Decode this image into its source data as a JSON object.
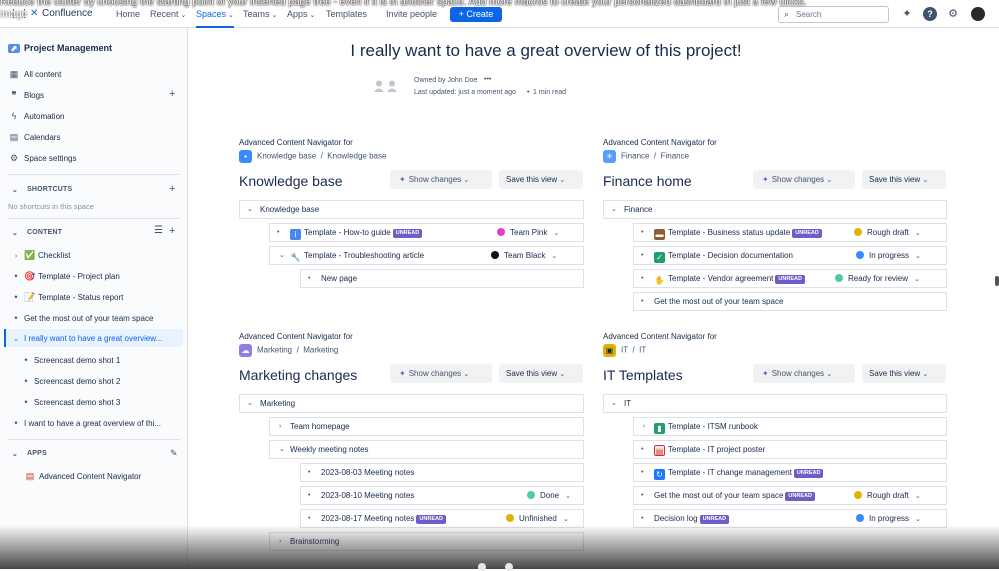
{
  "overlay": {
    "line1": "Reduce the clutter by choosing the starting point of your inserted page tree - even if it is in another space. Add more macros to create your personalized dashboard in just a few clicks.",
    "line2": "image"
  },
  "topnav": {
    "brand": "Confluence",
    "home": "Home",
    "recent": "Recent",
    "spaces": "Spaces",
    "teams": "Teams",
    "apps": "Apps",
    "templates": "Templates",
    "invite": "Invite people",
    "create": "Create",
    "search_placeholder": "Search",
    "accent": "#0c66e4"
  },
  "sidebar": {
    "space_name": "Project Management",
    "nav": [
      {
        "label": "All content",
        "icon": "grid-icon"
      },
      {
        "label": "Blogs",
        "icon": "quote-icon"
      },
      {
        "label": "Automation",
        "icon": "bolt-icon"
      },
      {
        "label": "Calendars",
        "icon": "calendar-icon"
      },
      {
        "label": "Space settings",
        "icon": "gear-icon"
      }
    ],
    "shortcuts_header": "SHORTCUTS",
    "shortcuts_empty": "No shortcuts in this space",
    "content_header": "CONTENT",
    "tree": [
      {
        "label": "Checklist",
        "emoji": "✅"
      },
      {
        "label": "Template - Project plan",
        "emoji": "🎯"
      },
      {
        "label": "Template - Status report",
        "emoji": "📝"
      },
      {
        "label": "Get the most out of your team space",
        "emoji": ""
      },
      {
        "label": "I really want to have a great overview...",
        "emoji": ""
      },
      {
        "label": "Screencast demo shot 1",
        "emoji": ""
      },
      {
        "label": "Screencast demo shot 2",
        "emoji": ""
      },
      {
        "label": "Screencast demo shot 3",
        "emoji": ""
      },
      {
        "label": "I want to have a great overview of thi...",
        "emoji": ""
      }
    ],
    "apps_header": "APPS",
    "apps": [
      {
        "label": "Advanced Content Navigator"
      }
    ]
  },
  "page": {
    "title": "I really want to have a great overview of this project!",
    "owner": "Owned by John Doe",
    "more": "•••",
    "updated": "Last updated: just a moment ago",
    "read_time": "1 min read"
  },
  "common": {
    "acn_label": "Advanced Content Navigator for",
    "show_changes": "Show changes",
    "save_view": "Save this view",
    "unread": "UNREAD"
  },
  "sections": {
    "kb": {
      "space": "Knowledge base",
      "page": "Knowledge base",
      "title": "Knowledge base",
      "root": "Knowledge base",
      "rows": [
        {
          "label": "Template - How-to guide",
          "status": "Team Pink",
          "color": "#e040c8"
        },
        {
          "label": "Template - Troubleshooting article",
          "status": "Team Black",
          "color": "#111111"
        },
        {
          "label": "New page"
        }
      ]
    },
    "fin": {
      "space": "Finance",
      "page": "Finance",
      "title": "Finance home",
      "root": "Finance",
      "rows": [
        {
          "label": "Template - Business status update",
          "status": "Rough draft",
          "color": "#e2b203"
        },
        {
          "label": "Template - Decision documentation",
          "status": "In progress",
          "color": "#388bff"
        },
        {
          "label": "Template - Vendor agreement",
          "status": "Ready for review",
          "color": "#4bce97"
        },
        {
          "label": "Get the most out of your team space"
        }
      ]
    },
    "mkt": {
      "space": "Marketing",
      "page": "Marketing",
      "title": "Marketing changes",
      "root": "Marketing",
      "rows": [
        {
          "label": "Team homepage"
        },
        {
          "label": "Weekly meeting notes"
        },
        {
          "label": "2023-08-03 Meeting notes"
        },
        {
          "label": "2023-08-10 Meeting notes",
          "status": "Done",
          "color": "#4bce97"
        },
        {
          "label": "2023-08-17 Meeting notes",
          "status": "Unfinished",
          "color": "#e2b203"
        },
        {
          "label": "Brainstorming"
        }
      ]
    },
    "it": {
      "space": "IT",
      "page": "IT",
      "title": "IT Templates",
      "root": "IT",
      "rows": [
        {
          "label": "Template - ITSM runbook"
        },
        {
          "label": "Template - IT project poster"
        },
        {
          "label": "Template - IT change management"
        },
        {
          "label": "Get the most out of your team space",
          "status": "Rough draft",
          "color": "#e2b203"
        },
        {
          "label": "Decision log",
          "status": "In progress",
          "color": "#388bff"
        }
      ]
    }
  }
}
